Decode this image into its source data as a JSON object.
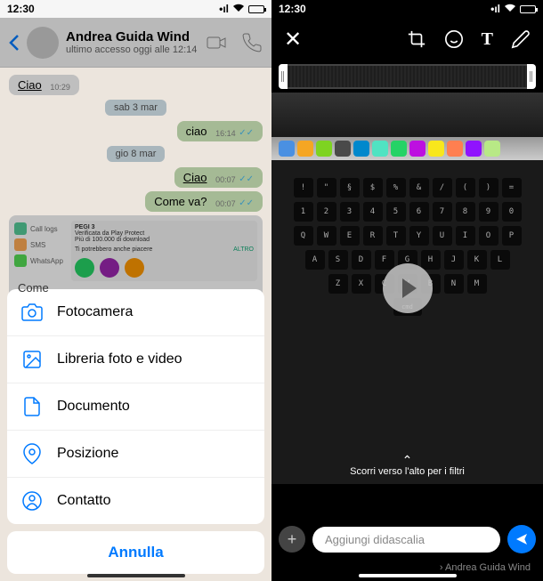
{
  "status": {
    "time": "12:30",
    "signal_type": "wifi"
  },
  "chat": {
    "contact_name": "Andrea Guida Wind",
    "last_seen": "ultimo accesso oggi alle 12:14",
    "messages": {
      "m1": {
        "text": "Ciao",
        "time": "10:29"
      },
      "date1": "sab 3 mar",
      "m2": {
        "text": "ciao",
        "time": "16:14"
      },
      "date2": "gio 8 mar",
      "m3": {
        "text": "Ciao",
        "time": "00:07"
      },
      "m4": {
        "text": "Come va?",
        "time": "00:07"
      }
    },
    "preview": {
      "items": [
        "Call logs",
        "SMS",
        "WhatsApp"
      ],
      "header": "PEGI 3",
      "sub1": "Verificata da Play Protect",
      "sub2": "Più di 100.000 di download",
      "sub3": "Ti potrebbero anche piacere",
      "altro": "ALTRO"
    },
    "partial": "Come"
  },
  "action_sheet": {
    "items": [
      {
        "icon": "camera",
        "label": "Fotocamera"
      },
      {
        "icon": "photo-library",
        "label": "Libreria foto e video"
      },
      {
        "icon": "document",
        "label": "Documento"
      },
      {
        "icon": "location",
        "label": "Posizione"
      },
      {
        "icon": "contact",
        "label": "Contatto"
      }
    ],
    "cancel": "Annulla"
  },
  "editor": {
    "swipe_hint": "Scorri verso l'alto per i filtri",
    "caption_placeholder": "Aggiungi didascalia",
    "recipient": "Andrea Guida Wind",
    "keyboard": {
      "row1": [
        "!",
        "\"",
        "§",
        "$",
        "%",
        "&",
        "/",
        "(",
        ")",
        "="
      ],
      "row2": [
        "1",
        "2",
        "3",
        "4",
        "5",
        "6",
        "7",
        "8",
        "9",
        "0"
      ],
      "row3": [
        "Q",
        "W",
        "E",
        "R",
        "T",
        "Y",
        "U",
        "I",
        "O",
        "P"
      ],
      "row4": [
        "A",
        "S",
        "D",
        "F",
        "G",
        "H",
        "J",
        "K",
        "L"
      ],
      "row5": [
        "Z",
        "X",
        "C",
        "V",
        "B",
        "N",
        "M"
      ],
      "cmd": "cmd"
    },
    "dock_colors": [
      "#4a90e2",
      "#f5a623",
      "#7ed321",
      "#4a4a4a",
      "#0088cc",
      "#50e3c2",
      "#25d366",
      "#bd10e0",
      "#f8e71c",
      "#ff7f50",
      "#9013fe",
      "#b8e986"
    ]
  },
  "colors": {
    "accent": "#007aff",
    "whatsapp_green": "#25d366",
    "bubble_out": "#dcf8c6"
  }
}
